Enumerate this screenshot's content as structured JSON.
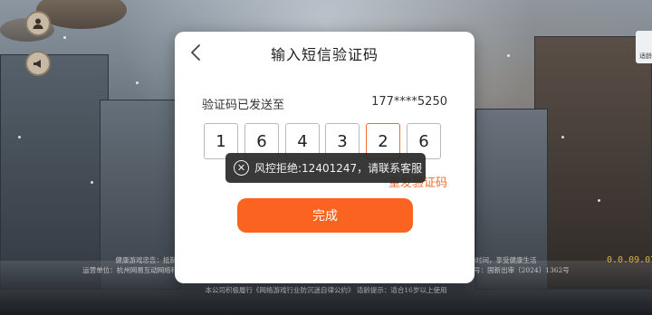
{
  "modal": {
    "title": "输入短信验证码",
    "sent_label": "验证码已发送至",
    "phone": "177****5250",
    "code_digits": [
      "1",
      "6",
      "4",
      "3",
      "2",
      "6"
    ],
    "active_index": 4,
    "resend_label": "重发验证码",
    "done_label": "完成"
  },
  "toast": {
    "message": "风控拒绝:12401247，请联系客服",
    "icon": "close-circle-icon"
  },
  "hud": {
    "right_chip": "适龄",
    "version": "0.0.09.07"
  },
  "footer": {
    "lines": [
      "健康游戏忠告：抵制不良游戏，拒绝盗版游戏，注意自我保护，谨防受骗上当，适度游戏益脑，沉迷游戏伤身，合理安排时间，享受健康生活",
      "运营单位：杭州网易互动网络科技有限公司  出版单位：杭州浮云网络科技有限公司  出版物号：ISBN 978-7-498-13700-5  审批文号：国新出审〔2024〕1362号",
      "软件著作权登记号：2023SR0545989  著作权人：杭州网易互动网络科技有限公司",
      "本公司积极履行《网络游戏行业防沉迷自律公约》  适龄提示：适合16岁以上使用"
    ]
  },
  "colors": {
    "accent": "#fb6420",
    "active_border": "#f06d2f",
    "toast_bg": "#282828"
  }
}
